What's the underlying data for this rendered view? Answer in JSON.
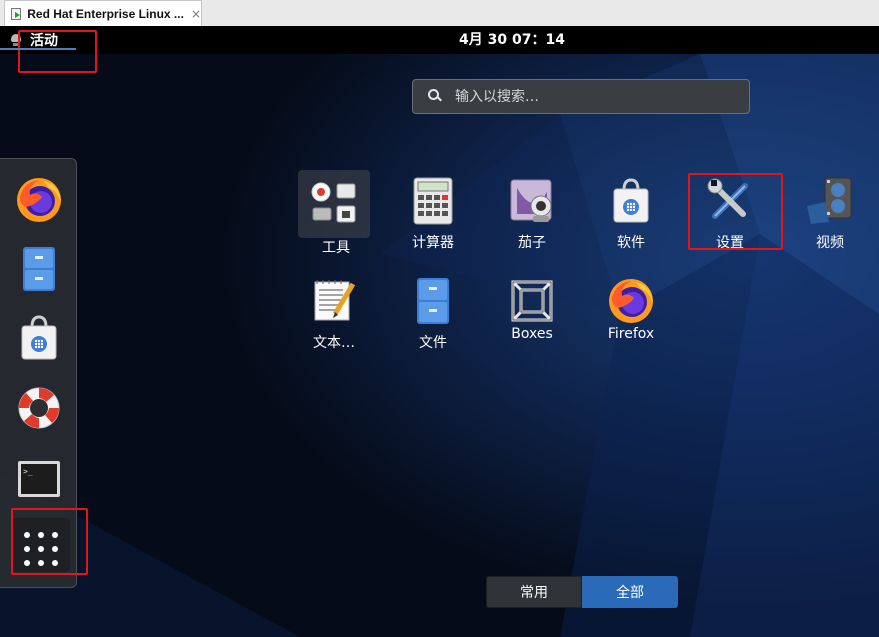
{
  "window": {
    "tab_title": "Red Hat Enterprise Linux ...",
    "tab_close": "×"
  },
  "topbar": {
    "activities": "活动",
    "clock": "4月 30 07：14"
  },
  "search": {
    "placeholder": "输入以搜索…"
  },
  "dash": {
    "items": [
      {
        "name": "Firefox",
        "icon": "firefox-icon"
      },
      {
        "name": "文件",
        "icon": "file-cabinet-icon"
      },
      {
        "name": "软件",
        "icon": "software-bag-icon"
      },
      {
        "name": "帮助",
        "icon": "lifebuoy-icon"
      },
      {
        "name": "终端",
        "icon": "terminal-icon"
      }
    ],
    "show_apps_icon": "app-grid-icon"
  },
  "apps": [
    {
      "label": "工具",
      "icon": "tools-folder-icon"
    },
    {
      "label": "计算器",
      "icon": "calculator-icon"
    },
    {
      "label": "茄子",
      "icon": "webcam-icon"
    },
    {
      "label": "软件",
      "icon": "software-bag-icon"
    },
    {
      "label": "设置",
      "icon": "wrench-screwdriver-icon"
    },
    {
      "label": "视频",
      "icon": "film-reel-icon"
    },
    {
      "label": "文本…",
      "icon": "text-editor-icon"
    },
    {
      "label": "文件",
      "icon": "file-cabinet-icon"
    },
    {
      "label": "Boxes",
      "icon": "boxes-icon"
    },
    {
      "label": "Firefox",
      "icon": "firefox-icon"
    }
  ],
  "view_toggle": {
    "frequent": "常用",
    "all": "全部",
    "selected": "全部"
  },
  "colors": {
    "highlight": "#e0161a",
    "selected_toggle": "#2a6ab8",
    "topbar": "#000000"
  }
}
